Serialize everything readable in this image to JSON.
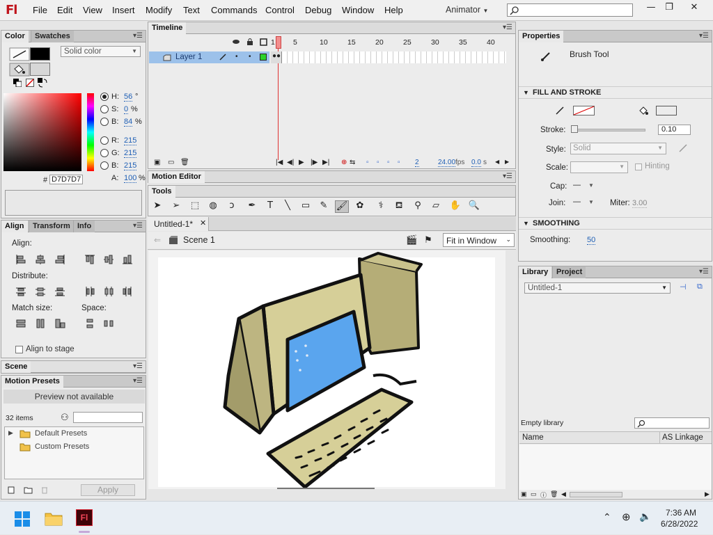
{
  "app": {
    "logo": "Fl"
  },
  "menu": [
    "File",
    "Edit",
    "View",
    "Insert",
    "Modify",
    "Text",
    "Commands",
    "Control",
    "Debug",
    "Window",
    "Help"
  ],
  "workspace": "Animator",
  "window_controls": {
    "minimize": "—",
    "restore": "❐",
    "close": "✕"
  },
  "color_panel": {
    "tabs": [
      "Color",
      "Swatches"
    ],
    "type": "Solid color",
    "fields": [
      {
        "k": "H:",
        "v": "56",
        "u": "°"
      },
      {
        "k": "S:",
        "v": "0",
        "u": "%"
      },
      {
        "k": "B:",
        "v": "84",
        "u": "%"
      },
      {
        "k": "R:",
        "v": "215",
        "u": ""
      },
      {
        "k": "G:",
        "v": "215",
        "u": ""
      },
      {
        "k": "B:",
        "v": "215",
        "u": ""
      },
      {
        "k": "A:",
        "v": "100",
        "u": "%"
      }
    ],
    "hex_label": "#",
    "hex": "D7D7D7",
    "stroke_color": "#000000",
    "fill_color": "#d7d7d7"
  },
  "align_panel": {
    "tabs": [
      "Align",
      "Transform",
      "Info"
    ],
    "align_label": "Align:",
    "distribute_label": "Distribute:",
    "match_size_label": "Match size:",
    "space_label": "Space:",
    "align_to_stage": "Align to stage"
  },
  "scene_panel": {
    "title": "Scene"
  },
  "motion_presets": {
    "title": "Motion Presets",
    "preview": "Preview not available",
    "count": "32 items",
    "folders": [
      "Default Presets",
      "Custom Presets"
    ],
    "apply": "Apply"
  },
  "timeline": {
    "title": "Timeline",
    "ruler": [
      "1",
      "5",
      "10",
      "15",
      "20",
      "25",
      "30",
      "35",
      "40"
    ],
    "layer": "Layer 1",
    "frame": "2",
    "fps": "24.00",
    "fps_unit": "fps",
    "time": "0.0",
    "time_unit": "s"
  },
  "motion_editor": {
    "title": "Motion Editor"
  },
  "tools_panel": {
    "title": "Tools"
  },
  "document": {
    "tab": "Untitled-1*",
    "scene": "Scene 1",
    "zoom": "Fit in Window"
  },
  "properties": {
    "title": "Properties",
    "tool": "Brush Tool",
    "fill_stroke_header": "FILL AND STROKE",
    "stroke_label": "Stroke:",
    "stroke_value": "0.10",
    "style_label": "Style:",
    "style_value": "Solid",
    "scale_label": "Scale:",
    "hinting": "Hinting",
    "cap_label": "Cap:",
    "cap_value": "—",
    "join_label": "Join:",
    "join_value": "—",
    "miter_label": "Miter:",
    "miter_value": "3.00",
    "smoothing_header": "SMOOTHING",
    "smoothing_label": "Smoothing:",
    "smoothing_value": "50"
  },
  "library": {
    "tabs": [
      "Library",
      "Project"
    ],
    "doc": "Untitled-1",
    "empty": "Empty library",
    "col_name": "Name",
    "col_linkage": "AS Linkage"
  },
  "taskbar": {
    "time": "7:36 AM",
    "date": "6/28/2022"
  }
}
